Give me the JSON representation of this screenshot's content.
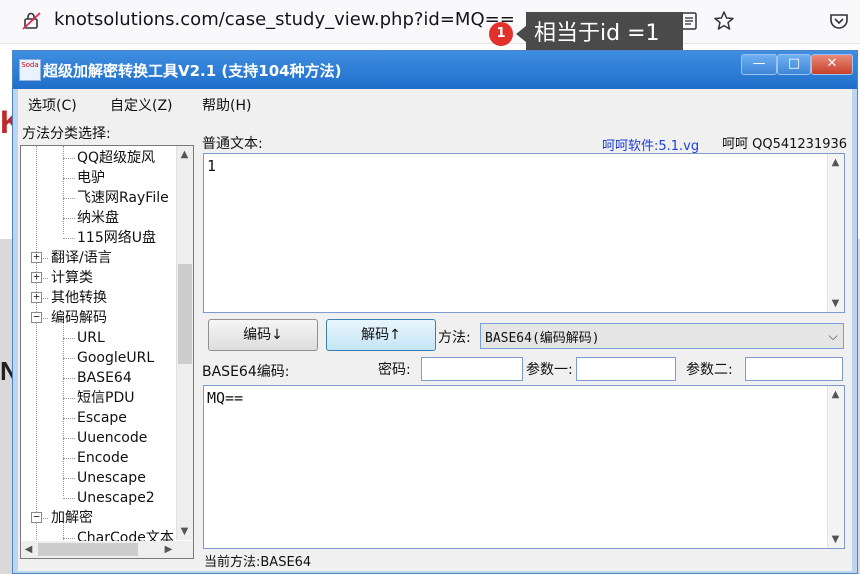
{
  "browser": {
    "url": "knotsolutions.com/case_study_view.php?id=MQ==",
    "badge_count": "1",
    "tooltip": "相当于id =1"
  },
  "window": {
    "title": "超级加解密转换工具V2.1 (支持104种方法)",
    "icon_text": "Soda",
    "minimize": "—",
    "maximize": "□",
    "close": "✕"
  },
  "menu": [
    "选项(C)",
    "自定义(Z)",
    "帮助(H)"
  ],
  "tree": {
    "label": "方法分类选择:",
    "rows": [
      {
        "text": "QQ超级旋风",
        "level": "child"
      },
      {
        "text": "电驴",
        "level": "child"
      },
      {
        "text": "飞速网RayFile",
        "level": "child"
      },
      {
        "text": "纳米盘",
        "level": "child"
      },
      {
        "text": "115网络U盘",
        "level": "child"
      },
      {
        "text": "翻译/语言",
        "level": "parent",
        "expander": "+"
      },
      {
        "text": "计算类",
        "level": "parent",
        "expander": "+"
      },
      {
        "text": "其他转换",
        "level": "parent",
        "expander": "+"
      },
      {
        "text": "编码解码",
        "level": "parent",
        "expander": "−"
      },
      {
        "text": "URL",
        "level": "child"
      },
      {
        "text": "GoogleURL",
        "level": "child"
      },
      {
        "text": "BASE64",
        "level": "child"
      },
      {
        "text": "短信PDU",
        "level": "child"
      },
      {
        "text": "Escape",
        "level": "child"
      },
      {
        "text": "Uuencode",
        "level": "child"
      },
      {
        "text": "Encode",
        "level": "child"
      },
      {
        "text": "Unescape",
        "level": "child"
      },
      {
        "text": "Unescape2",
        "level": "child"
      },
      {
        "text": "加解密",
        "level": "parent",
        "expander": "−"
      },
      {
        "text": "CharCode文本",
        "level": "child"
      }
    ]
  },
  "plain": {
    "label": "普通文本:",
    "value": "1",
    "link": "呵呵软件:5.1.vg",
    "qq": "呵呵 QQ541231936"
  },
  "actions": {
    "encode": "编码↓",
    "decode": "解码↑",
    "method_label": "方法:",
    "method_value": "BASE64(编码解码)"
  },
  "params": {
    "encoded_label": "BASE64编码:",
    "password_label": "密码:",
    "param1_label": "参数一:",
    "param2_label": "参数二:"
  },
  "encoded": {
    "value": "MQ=="
  },
  "status": "当前方法:BASE64"
}
